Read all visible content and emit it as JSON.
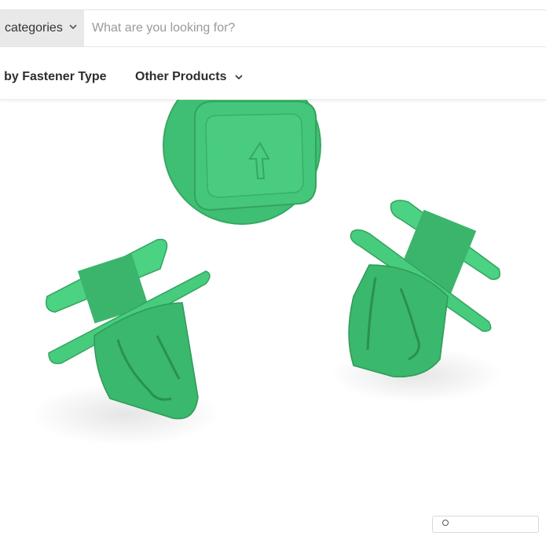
{
  "header": {
    "category_select": {
      "label": "categories",
      "icon": "chevron-down-icon"
    },
    "search": {
      "placeholder": "What are you looking for?",
      "value": ""
    }
  },
  "nav": {
    "items": [
      {
        "label": "ch by Fastener Type",
        "has_dropdown": false
      },
      {
        "label": "Other Products",
        "has_dropdown": true
      }
    ]
  },
  "product": {
    "image_subject": "three green plastic push-type trim clips",
    "color": "#3dbb72"
  }
}
